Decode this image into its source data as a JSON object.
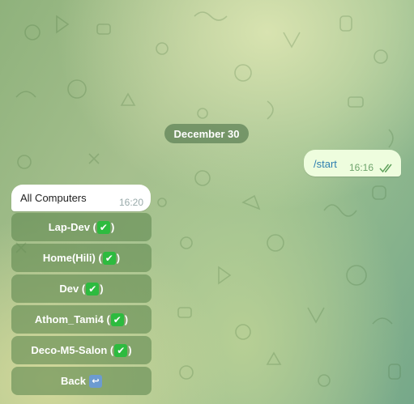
{
  "date_separator": "December 30",
  "outgoing": {
    "text": "/start",
    "time": "16:16",
    "status_icon": "double-check-icon"
  },
  "incoming": {
    "text": "All Computers",
    "time": "16:20"
  },
  "keyboard": {
    "buttons": [
      {
        "label": "Lap-Dev (",
        "suffix": ")",
        "icon": "check-mark-button-icon"
      },
      {
        "label": "Home(Hili) (",
        "suffix": ")",
        "icon": "check-mark-button-icon"
      },
      {
        "label": "Dev (",
        "suffix": ")",
        "icon": "check-mark-button-icon"
      },
      {
        "label": "Athom_Tami4 (",
        "suffix": ")",
        "icon": "check-mark-button-icon"
      },
      {
        "label": "Deco-M5-Salon (",
        "suffix": ")",
        "icon": "check-mark-button-icon"
      }
    ],
    "back": {
      "label": "Back",
      "icon": "back-arrow-icon"
    }
  },
  "colors": {
    "outgoing_bubble": "#eefdde",
    "incoming_bubble": "#ffffff",
    "button_bg": "#628a52",
    "check_emoji": "#2dbb3f",
    "back_emoji": "#6c9bd0"
  }
}
